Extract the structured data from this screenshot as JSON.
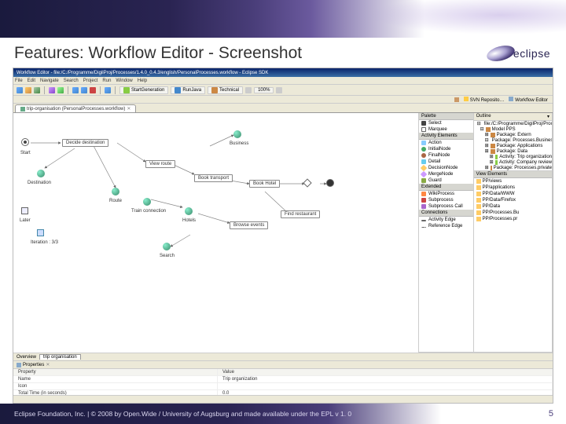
{
  "title": "Features: Workflow Editor - Screenshot",
  "logo_text": "eclipse",
  "window": {
    "title": "Workflow Editor - file:/C:/Programme/DigilProj/Processes/1.4.0_0.4.3/english/PersonalProcesses.workflow - Eclipse SDK"
  },
  "menu": [
    "File",
    "Edit",
    "Navigate",
    "Search",
    "Project",
    "Run",
    "Window",
    "Help"
  ],
  "toolbar": {
    "btn_start": "StartGeneration",
    "btn_run": "RunJava",
    "btn_tech": "Technical",
    "zoom": "100%"
  },
  "perspectives": {
    "svn": "SVN Reposito…",
    "wf": "Workflow Editor"
  },
  "editor_tab": "trip-organisation (PersonalProcesses.workflow)",
  "nodes": {
    "start": "Start",
    "later": "Later",
    "decide_dest": "Decide destination",
    "destination": "Destination",
    "route": "Route",
    "view_route": "View route",
    "book_transport": "Book transport",
    "train_conn": "Train connection",
    "search": "Search",
    "hotels": "Hotels",
    "book_hotel": "Book Hotel",
    "browse_events": "Browse events",
    "business": "Business",
    "find_rest": "Find restaurant",
    "iter_label": "Iteration : 3/3"
  },
  "palette": {
    "header": "Palette",
    "select": "Select",
    "marquee": "Marquee",
    "act_hdr": "Activity Elements",
    "action": "Action",
    "init": "InitialNode",
    "final": "FinalNode",
    "detail": "Detail",
    "decision": "DecisionNode",
    "merge": "MergeNode",
    "guard": "Guard",
    "ext_hdr": "Extended",
    "wiki": "WikiProcess",
    "subproc": "Subprocess",
    "subcall": "Subprocess Call",
    "conn_hdr": "Connections",
    "act_edge": "Activity Edge",
    "ref_edge": "Reference Edge"
  },
  "outline": {
    "header": "Outline",
    "root": "file:/C:/Programme/DigilProj/Process",
    "model": "Model PPS",
    "pkg_extern": "Package: Extern",
    "pkg_biz": "Package: Processes.Business",
    "pkg_apps": "Package: Applications",
    "pkg_data": "Package: Data",
    "act_trip": "Activity: Trip organization",
    "act_comp": "Activity: Company review",
    "pkg_priv": "Package: Processes.private"
  },
  "files": {
    "header": "View Elements",
    "items": [
      "PP/views",
      "PP/applications",
      "PP/Data/WWW",
      "PP/Data/Firefox",
      "PP/Data",
      "PP/Processes.Bu",
      "PP/Processes.pr"
    ]
  },
  "bottom_tabs": {
    "overview": "Overview",
    "trip": "trip organisation"
  },
  "properties": {
    "tab": "Properties",
    "col_prop": "Property",
    "col_val": "Value",
    "rows": [
      {
        "p": "Name",
        "v": "Trip organization"
      },
      {
        "p": "Icon",
        "v": ""
      },
      {
        "p": "Total Time (in seconds)",
        "v": "0.0"
      }
    ]
  },
  "footer": "Eclipse Foundation, Inc. | © 2008 by Open.Wide / University of Augsburg and made available under the EPL v 1. 0",
  "page": "5"
}
